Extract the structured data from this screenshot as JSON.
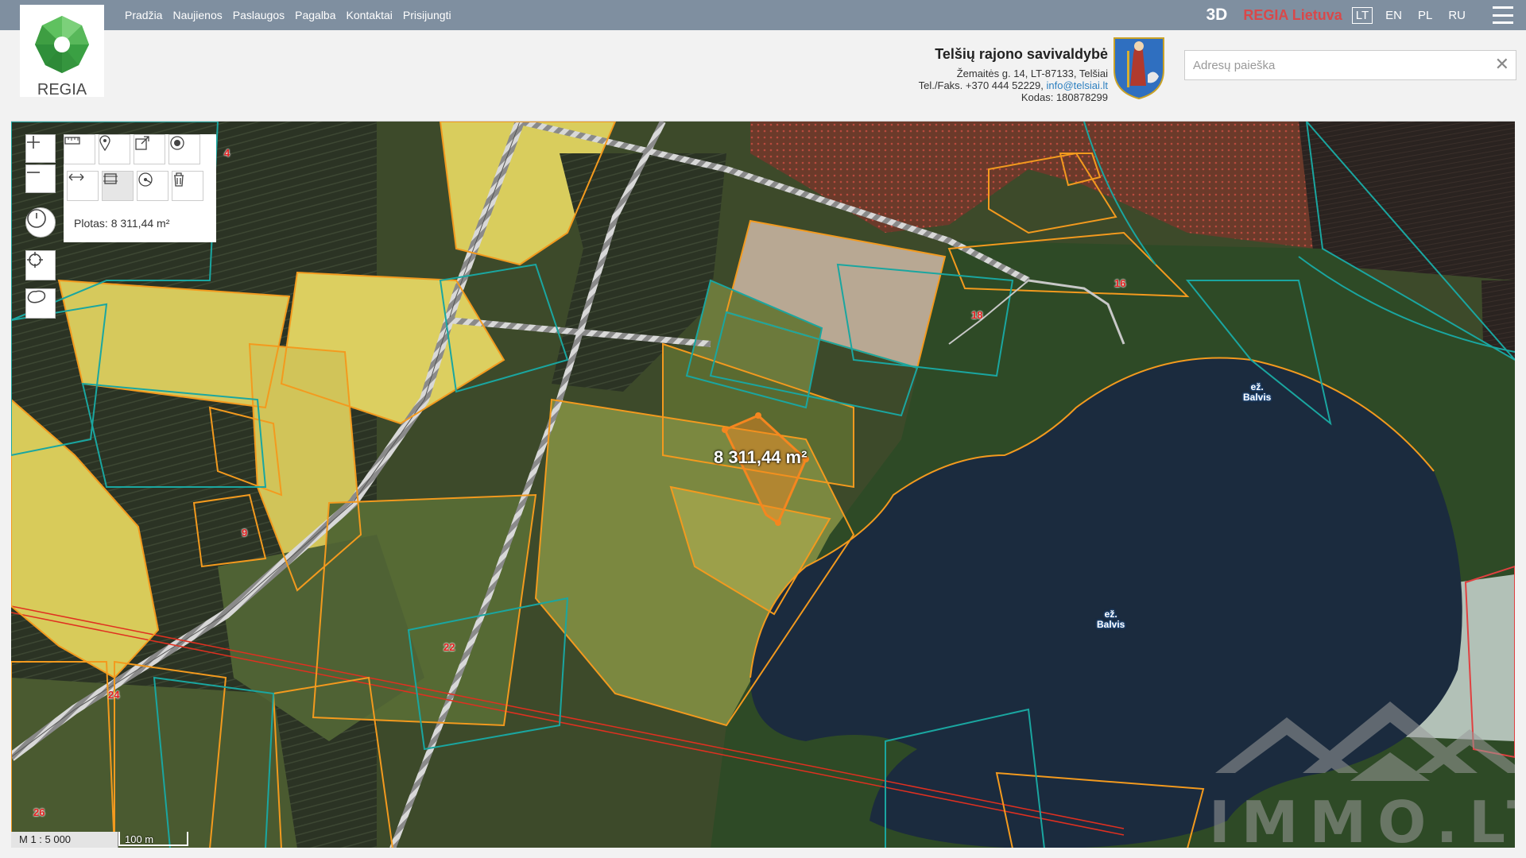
{
  "nav": {
    "items": [
      "Pradžia",
      "Naujienos",
      "Paslaugos",
      "Pagalba",
      "Kontaktai",
      "Prisijungti"
    ]
  },
  "top_right": {
    "btn_3d": "3D",
    "regia_lietuva": "REGIA Lietuva",
    "languages": [
      "LT",
      "EN",
      "PL",
      "RU"
    ],
    "active_language": "LT"
  },
  "logo": {
    "text": "REGIA"
  },
  "municipality": {
    "name": "Telšių rajono savivaldybė",
    "address": "Žemaitės g. 14, LT-87133, Telšiai",
    "phone_prefix": "Tel./Faks. +370 444 52229, ",
    "email": "info@telsiai.lt",
    "code": "Kodas: 180878299"
  },
  "search": {
    "placeholder": "Adresų paieška",
    "value": ""
  },
  "measure": {
    "area_text": "Plotas: 8 311,44 m²"
  },
  "map": {
    "selected_area_label": "8 311,44 m²",
    "lake_labels": [
      "ež.\nBalvis",
      "ež.\nBalvis"
    ],
    "parcel_numbers": [
      "4",
      "16",
      "18",
      "9",
      "22",
      "24",
      "26"
    ],
    "scale_ratio": "M 1 : 5 000",
    "scale_length": "100 m"
  },
  "watermark": {
    "text": "IMMO.LT"
  },
  "colors": {
    "topbar": "#7f8fa0",
    "accent_red": "#d9484a",
    "parcel_orange": "#f39a1e",
    "parcel_teal": "#1aa6a0",
    "selected_parcel": "#f5861f",
    "lake": "#1b2b3e"
  }
}
